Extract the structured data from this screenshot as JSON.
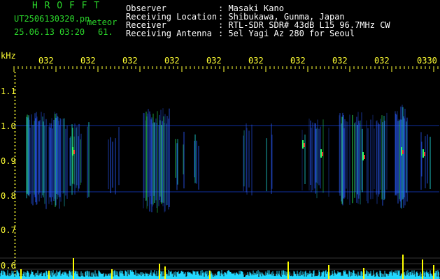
{
  "header": {
    "app_name": "H R O F F T",
    "file_name": "UT2506130320.pn",
    "mode": "meteor",
    "date_time": "25.06.13 03:20",
    "counter": "61.",
    "info": [
      {
        "label": "Observer",
        "value": ": Masaki Kano"
      },
      {
        "label": "Receiving Location",
        "value": ": Shibukawa, Gunma, Japan"
      },
      {
        "label": "Receiver",
        "value": ": RTL-SDR SDR# 43dB L15 96.7MHz CW"
      },
      {
        "label": "Receiving Antenna",
        "value": ": 5el Yagi Az 280 for Seoul"
      }
    ]
  },
  "axes": {
    "y_unit": "kHz",
    "y_ticks": [
      "1.1",
      "1.0",
      "0.9",
      "0.8",
      "0.7",
      "0.6"
    ],
    "x_ticks": [
      "032",
      "032",
      "032",
      "032",
      "032",
      "032",
      "032",
      "032",
      "032",
      "0330"
    ]
  },
  "colors": {
    "background": "#000000",
    "text_green": "#2bd62b",
    "text_white": "#ffffff",
    "tick_yellow": "#ffff33",
    "signal_blue": "#2a5cff",
    "signal_cyan": "#20e0e0",
    "signal_green": "#30ff60",
    "signal_red": "#ff3030",
    "level_yellow": "#ffff00",
    "level_cyan": "#22d8ff"
  }
}
